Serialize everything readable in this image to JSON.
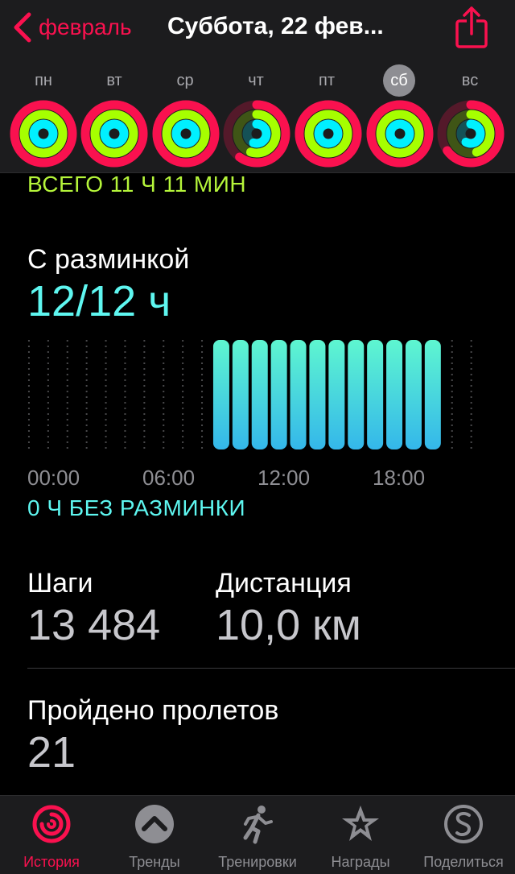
{
  "header": {
    "back_label": "февраль",
    "title": "Суббота, 22 фев...",
    "weekdays": [
      "пн",
      "вт",
      "ср",
      "чт",
      "пт",
      "сб",
      "вс"
    ],
    "selected_day_index": 5,
    "rings": [
      {
        "move": 1.0,
        "exercise": 1.0,
        "stand": 1.0
      },
      {
        "move": 1.0,
        "exercise": 1.0,
        "stand": 1.0
      },
      {
        "move": 1.0,
        "exercise": 1.0,
        "stand": 1.0
      },
      {
        "move": 0.6,
        "exercise": 0.55,
        "stand": 0.55
      },
      {
        "move": 1.0,
        "exercise": 1.0,
        "stand": 1.0
      },
      {
        "move": 1.0,
        "exercise": 1.0,
        "stand": 1.0
      },
      {
        "move": 0.65,
        "exercise": 0.45,
        "stand": 0.58
      }
    ]
  },
  "colors": {
    "move": "#fa114f",
    "exercise": "#a6ff00",
    "stand": "#00f0ff",
    "accent": "#fa114f"
  },
  "summary": {
    "total": "ВСЕГО 11 Ч 11 МИН"
  },
  "stand": {
    "label": "С разминкой",
    "value": "12/12 ч",
    "no_stand": "0 Ч БЕЗ РАЗМИНКИ",
    "ticks": [
      "00:00",
      "06:00",
      "12:00",
      "18:00"
    ]
  },
  "chart_data": {
    "type": "bar",
    "x": [
      0,
      1,
      2,
      3,
      4,
      5,
      6,
      7,
      8,
      9,
      10,
      11,
      12,
      13,
      14,
      15,
      16,
      17,
      18,
      19,
      20,
      21,
      22,
      23
    ],
    "values": [
      0,
      0,
      0,
      0,
      0,
      0,
      0,
      0,
      0,
      0,
      1,
      1,
      1,
      1,
      1,
      1,
      1,
      1,
      1,
      1,
      1,
      1,
      0,
      0
    ],
    "xticks": [
      "00:00",
      "06:00",
      "12:00",
      "18:00"
    ],
    "ylim": [
      0,
      1
    ]
  },
  "stats": {
    "steps_label": "Шаги",
    "steps_value": "13 484",
    "distance_label": "Дистанция",
    "distance_value": "10,0 км",
    "flights_label": "Пройдено пролетов",
    "flights_value": "21"
  },
  "tabs": [
    {
      "label": "История",
      "icon": "history-rings-icon",
      "active": true
    },
    {
      "label": "Тренды",
      "icon": "trends-icon",
      "active": false
    },
    {
      "label": "Тренировки",
      "icon": "workout-runner-icon",
      "active": false
    },
    {
      "label": "Награды",
      "icon": "awards-star-icon",
      "active": false
    },
    {
      "label": "Поделиться",
      "icon": "sharing-icon",
      "active": false
    }
  ]
}
